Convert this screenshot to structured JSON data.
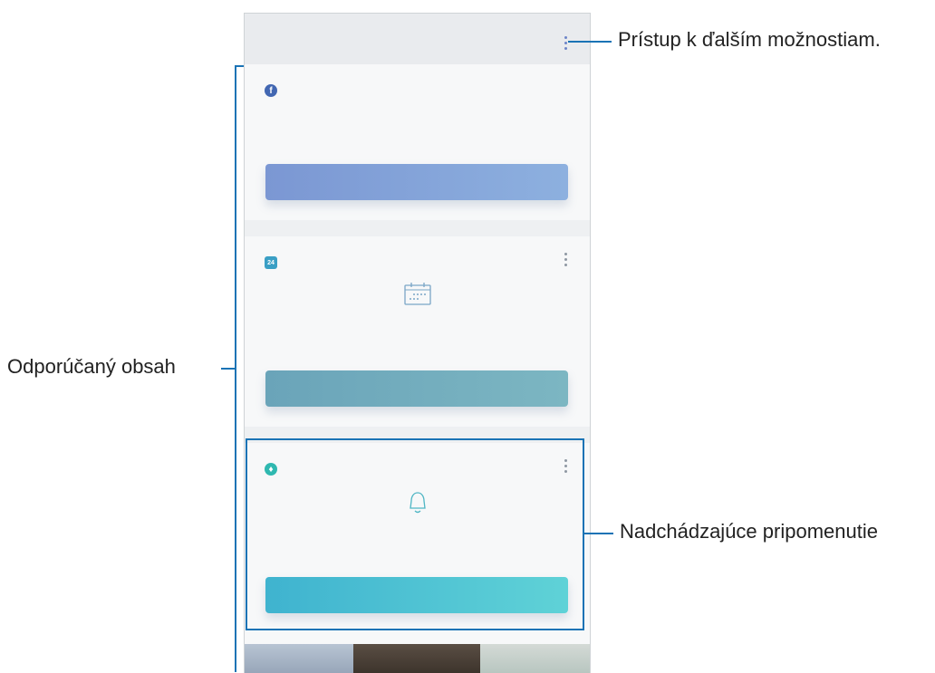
{
  "callouts": {
    "more_options": "Prístup k ďalším možnostiam.",
    "recommended_content": "Odporúčaný obsah",
    "upcoming_reminders": "Nadchádzajúce pripomenutie"
  },
  "screen": {
    "topbar": {
      "title": "",
      "more_icon": "more-vertical-icon"
    },
    "cards": [
      {
        "id": "facebook",
        "icon": "facebook-icon",
        "title": "",
        "desc": "",
        "buttons": [
          "",
          ""
        ],
        "color": "#7b97d3"
      },
      {
        "id": "schedule",
        "icon": "calendar-icon",
        "title": "",
        "desc": "",
        "buttons": [
          ""
        ],
        "color": "#6aa4b9"
      },
      {
        "id": "reminders",
        "icon": "reminder-icon",
        "title": "",
        "desc": "",
        "buttons": [
          ""
        ],
        "color": "#3fb3cf"
      }
    ]
  },
  "colors": {
    "accent": "#1a73b5"
  }
}
